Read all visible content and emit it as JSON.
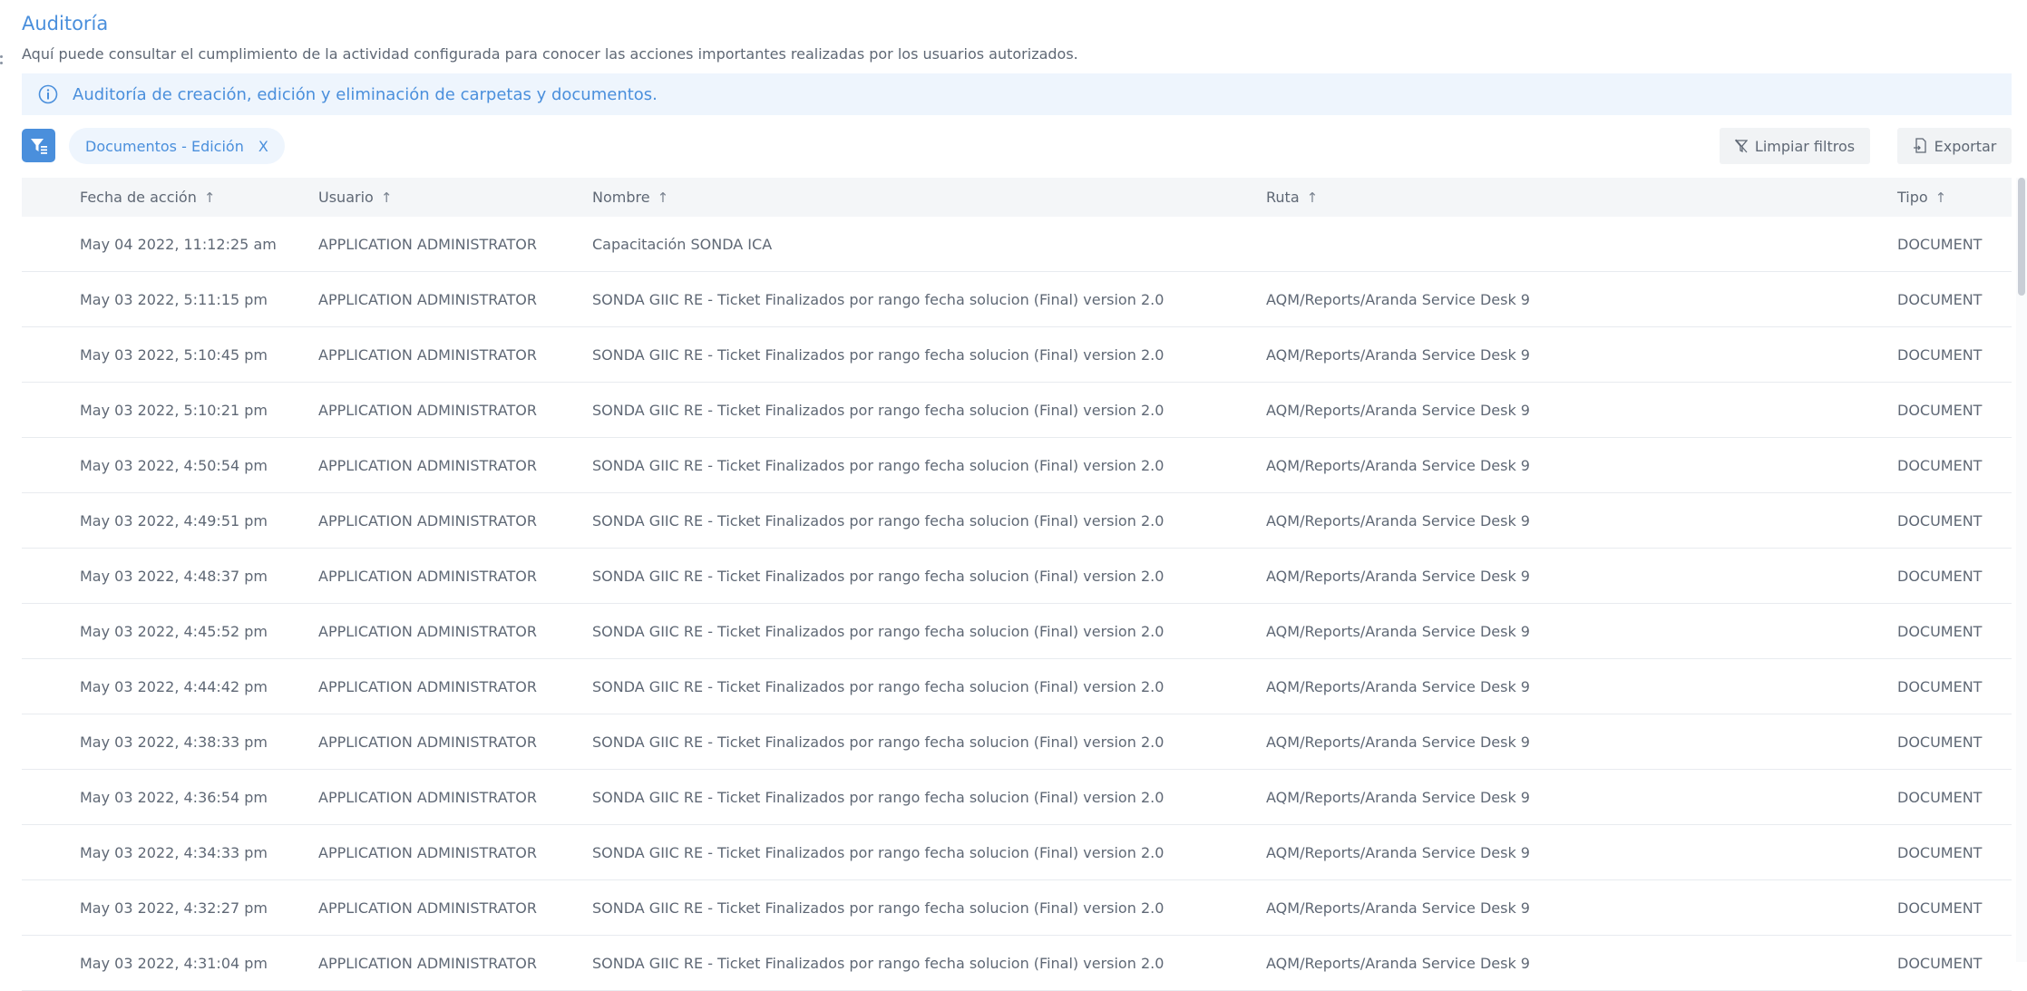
{
  "page": {
    "title": "Auditoría",
    "subtitle": "Aquí puede consultar el cumplimiento de la actividad configurada para conocer las acciones importantes realizadas por los usuarios autorizados.",
    "info_text": "Auditoría de creación, edición y eliminación de carpetas y documentos."
  },
  "toolbar": {
    "filter_chip": "Documentos - Edición",
    "chip_close": "X",
    "clear_filters_label": "Limpiar filtros",
    "export_label": "Exportar"
  },
  "table": {
    "columns": [
      "Fecha de acción",
      "Usuario",
      "Nombre",
      "Ruta",
      "Tipo"
    ],
    "sort_arrow": "↑",
    "rows": [
      {
        "fecha": "May 04 2022, 11:12:25 am",
        "usuario": "APPLICATION ADMINISTRATOR",
        "nombre": "Capacitación SONDA ICA",
        "ruta": "",
        "tipo": "DOCUMENT"
      },
      {
        "fecha": "May 03 2022, 5:11:15 pm",
        "usuario": "APPLICATION ADMINISTRATOR",
        "nombre": "SONDA GIIC RE - Ticket Finalizados por rango fecha solucion (Final) version 2.0",
        "ruta": "AQM/Reports/Aranda Service Desk 9",
        "tipo": "DOCUMENT"
      },
      {
        "fecha": "May 03 2022, 5:10:45 pm",
        "usuario": "APPLICATION ADMINISTRATOR",
        "nombre": "SONDA GIIC RE - Ticket Finalizados por rango fecha solucion (Final) version 2.0",
        "ruta": "AQM/Reports/Aranda Service Desk 9",
        "tipo": "DOCUMENT"
      },
      {
        "fecha": "May 03 2022, 5:10:21 pm",
        "usuario": "APPLICATION ADMINISTRATOR",
        "nombre": "SONDA GIIC RE - Ticket Finalizados por rango fecha solucion (Final) version 2.0",
        "ruta": "AQM/Reports/Aranda Service Desk 9",
        "tipo": "DOCUMENT"
      },
      {
        "fecha": "May 03 2022, 4:50:54 pm",
        "usuario": "APPLICATION ADMINISTRATOR",
        "nombre": "SONDA GIIC RE - Ticket Finalizados por rango fecha solucion (Final) version 2.0",
        "ruta": "AQM/Reports/Aranda Service Desk 9",
        "tipo": "DOCUMENT"
      },
      {
        "fecha": "May 03 2022, 4:49:51 pm",
        "usuario": "APPLICATION ADMINISTRATOR",
        "nombre": "SONDA GIIC RE - Ticket Finalizados por rango fecha solucion (Final) version 2.0",
        "ruta": "AQM/Reports/Aranda Service Desk 9",
        "tipo": "DOCUMENT"
      },
      {
        "fecha": "May 03 2022, 4:48:37 pm",
        "usuario": "APPLICATION ADMINISTRATOR",
        "nombre": "SONDA GIIC RE - Ticket Finalizados por rango fecha solucion (Final) version 2.0",
        "ruta": "AQM/Reports/Aranda Service Desk 9",
        "tipo": "DOCUMENT"
      },
      {
        "fecha": "May 03 2022, 4:45:52 pm",
        "usuario": "APPLICATION ADMINISTRATOR",
        "nombre": "SONDA GIIC RE - Ticket Finalizados por rango fecha solucion (Final) version 2.0",
        "ruta": "AQM/Reports/Aranda Service Desk 9",
        "tipo": "DOCUMENT"
      },
      {
        "fecha": "May 03 2022, 4:44:42 pm",
        "usuario": "APPLICATION ADMINISTRATOR",
        "nombre": "SONDA GIIC RE - Ticket Finalizados por rango fecha solucion (Final) version 2.0",
        "ruta": "AQM/Reports/Aranda Service Desk 9",
        "tipo": "DOCUMENT"
      },
      {
        "fecha": "May 03 2022, 4:38:33 pm",
        "usuario": "APPLICATION ADMINISTRATOR",
        "nombre": "SONDA GIIC RE - Ticket Finalizados por rango fecha solucion (Final) version 2.0",
        "ruta": "AQM/Reports/Aranda Service Desk 9",
        "tipo": "DOCUMENT"
      },
      {
        "fecha": "May 03 2022, 4:36:54 pm",
        "usuario": "APPLICATION ADMINISTRATOR",
        "nombre": "SONDA GIIC RE - Ticket Finalizados por rango fecha solucion (Final) version 2.0",
        "ruta": "AQM/Reports/Aranda Service Desk 9",
        "tipo": "DOCUMENT"
      },
      {
        "fecha": "May 03 2022, 4:34:33 pm",
        "usuario": "APPLICATION ADMINISTRATOR",
        "nombre": "SONDA GIIC RE - Ticket Finalizados por rango fecha solucion (Final) version 2.0",
        "ruta": "AQM/Reports/Aranda Service Desk 9",
        "tipo": "DOCUMENT"
      },
      {
        "fecha": "May 03 2022, 4:32:27 pm",
        "usuario": "APPLICATION ADMINISTRATOR",
        "nombre": "SONDA GIIC RE - Ticket Finalizados por rango fecha solucion (Final) version 2.0",
        "ruta": "AQM/Reports/Aranda Service Desk 9",
        "tipo": "DOCUMENT"
      },
      {
        "fecha": "May 03 2022, 4:31:04 pm",
        "usuario": "APPLICATION ADMINISTRATOR",
        "nombre": "SONDA GIIC RE - Ticket Finalizados por rango fecha solucion (Final) version 2.0",
        "ruta": "AQM/Reports/Aranda Service Desk 9",
        "tipo": "DOCUMENT"
      }
    ]
  },
  "icons": {
    "info": "info-circle-icon",
    "filter": "filter-list-icon",
    "clear": "funnel-clear-icon",
    "export": "file-export-icon"
  },
  "colors": {
    "accent": "#4a8fdc",
    "info_bg": "#eef5fd",
    "header_bg": "#f4f6f8"
  }
}
